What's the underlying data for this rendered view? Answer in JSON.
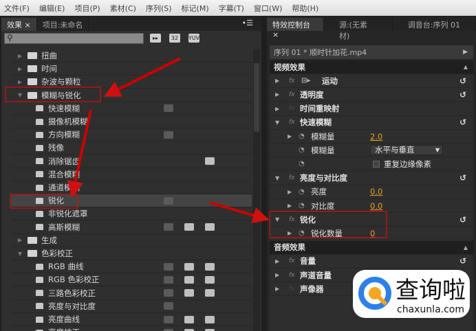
{
  "menu": [
    "文件(F)",
    "编辑(E)",
    "项目(P)",
    "素材(C)",
    "序列(S)",
    "标记(M)",
    "字幕(T)",
    "窗口(W)",
    "帮助(H)"
  ],
  "left_panel": {
    "tabs": [
      "效果",
      "项目:未命名"
    ],
    "search_placeholder": "",
    "filter_badges": [
      "32",
      "YUV"
    ],
    "items": [
      {
        "label": "扭曲",
        "type": "folder",
        "expanded": false
      },
      {
        "label": "时间",
        "type": "folder",
        "expanded": false
      },
      {
        "label": "杂波与颗粒",
        "type": "folder",
        "expanded": false
      },
      {
        "label": "模糊与锐化",
        "type": "folder",
        "expanded": true
      },
      {
        "label": "快速模糊",
        "type": "effect",
        "badges": [
          true,
          false,
          false
        ]
      },
      {
        "label": "摄像机模糊",
        "type": "effect",
        "badges": [
          false,
          false,
          false
        ]
      },
      {
        "label": "方向模糊",
        "type": "effect",
        "badges": [
          true,
          false,
          false
        ]
      },
      {
        "label": "残像",
        "type": "effect",
        "badges": [
          false,
          false,
          false
        ]
      },
      {
        "label": "消除锯齿",
        "type": "effect",
        "badges": [
          false,
          false,
          true
        ]
      },
      {
        "label": "混合模糊",
        "type": "effect",
        "badges": [
          false,
          false,
          false
        ]
      },
      {
        "label": "通道模糊",
        "type": "effect",
        "badges": [
          false,
          false,
          false
        ]
      },
      {
        "label": "锐化",
        "type": "effect",
        "selected": true,
        "badges": [
          true,
          false,
          false
        ]
      },
      {
        "label": "非锐化遮罩",
        "type": "effect",
        "badges": [
          false,
          false,
          false
        ]
      },
      {
        "label": "高斯模糊",
        "type": "effect",
        "badges": [
          true,
          true,
          true
        ]
      },
      {
        "label": "生成",
        "type": "folder",
        "expanded": false
      },
      {
        "label": "色彩校正",
        "type": "folder",
        "expanded": true
      },
      {
        "label": "RGB 曲线",
        "type": "effect",
        "badges": [
          true,
          true,
          true
        ]
      },
      {
        "label": "RGB 色彩校正",
        "type": "effect",
        "badges": [
          true,
          true,
          true
        ]
      },
      {
        "label": "三路色彩校正",
        "type": "effect",
        "badges": [
          true,
          true,
          true
        ]
      },
      {
        "label": "亮度与对比度",
        "type": "effect",
        "badges": [
          true,
          false,
          false
        ]
      },
      {
        "label": "亮度曲线",
        "type": "effect",
        "badges": [
          true,
          true,
          true
        ]
      },
      {
        "label": "亮度校正",
        "type": "effect",
        "badges": [
          true,
          true,
          true
        ]
      }
    ]
  },
  "right_panel": {
    "tabs": [
      "特效控制台",
      "源:(无素材)",
      "调音台:序列 01"
    ],
    "sequence": "序列 01 * 顺时针加花.mp4",
    "rows": [
      {
        "kind": "header",
        "label": "视频效果"
      },
      {
        "kind": "effect",
        "label": "运动",
        "fx": true,
        "motion_icon": true,
        "reset": true
      },
      {
        "kind": "effect",
        "label": "透明度",
        "fx": true,
        "reset": true
      },
      {
        "kind": "effect",
        "label": "时间重映射",
        "fx": false
      },
      {
        "kind": "effect",
        "label": "快速模糊",
        "fx": true,
        "open": true,
        "reset": true
      },
      {
        "kind": "param",
        "label": "模糊量",
        "value": "2.0",
        "twirl": true
      },
      {
        "kind": "param",
        "label": "模糊量",
        "dropdown": "水平与垂直"
      },
      {
        "kind": "param",
        "label": "",
        "checkbox": "重复边缘像素"
      },
      {
        "kind": "effect",
        "label": "亮度与对比度",
        "fx": true,
        "open": true,
        "reset": true
      },
      {
        "kind": "param",
        "label": "亮度",
        "value": "0.0",
        "twirl": true
      },
      {
        "kind": "param",
        "label": "对比度",
        "value": "0.0",
        "twirl": true
      },
      {
        "kind": "effect",
        "label": "锐化",
        "fx": true,
        "open": true,
        "reset": true
      },
      {
        "kind": "param",
        "label": "锐化数量",
        "value": "0",
        "twirl": true
      },
      {
        "kind": "header",
        "label": "音频效果"
      },
      {
        "kind": "effect",
        "label": "音量",
        "fx": true,
        "reset": true
      },
      {
        "kind": "effect",
        "label": "声道音量",
        "fx": true,
        "reset": true
      },
      {
        "kind": "effect",
        "label": "声像器",
        "fx": false
      }
    ]
  },
  "watermark": {
    "text": "查询啦",
    "url_text": "chaxunla.com"
  },
  "colors": {
    "annotation": "#d01010",
    "value": "#e8a21b"
  }
}
